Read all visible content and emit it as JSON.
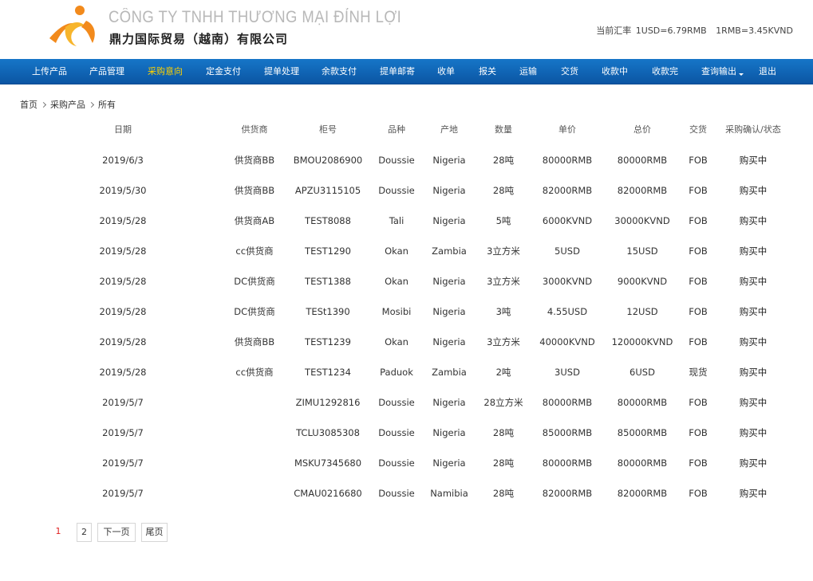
{
  "header": {
    "company_vn": "CÔNG TY TNHH THƯƠNG MẠI ĐỈNH LỢI",
    "company_cn": "鼎力国际贸易（越南）有限公司",
    "rate_label": "当前汇率",
    "rate_usd": "1USD=6.79RMB",
    "rate_rmb": "1RMB=3.45KVND"
  },
  "nav": {
    "items": [
      "上传产品",
      "产品管理",
      "采购意向",
      "定金支付",
      "提单处理",
      "余款支付",
      "提单邮寄",
      "收单",
      "报关",
      "运输",
      "交货",
      "收款中",
      "收款完",
      "查询输出",
      "退出"
    ],
    "active": "采购意向"
  },
  "breadcrumb": [
    "首页",
    "采购产品",
    "所有"
  ],
  "table": {
    "headers": [
      "日期",
      "供货商",
      "柜号",
      "品种",
      "产地",
      "数量",
      "单价",
      "总价",
      "交货",
      "采购确认/状态"
    ],
    "rows": [
      [
        "2019/6/3",
        "供货商BB",
        "BMOU2086900",
        "Doussie",
        "Nigeria",
        "28吨",
        "80000RMB",
        "80000RMB",
        "FOB",
        "购买中"
      ],
      [
        "2019/5/30",
        "供货商BB",
        "APZU3115105",
        "Doussie",
        "Nigeria",
        "28吨",
        "82000RMB",
        "82000RMB",
        "FOB",
        "购买中"
      ],
      [
        "2019/5/28",
        "供货商AB",
        "TEST8088",
        "Tali",
        "Nigeria",
        "5吨",
        "6000KVND",
        "30000KVND",
        "FOB",
        "购买中"
      ],
      [
        "2019/5/28",
        "cc供货商",
        "TEST1290",
        "Okan",
        "Zambia",
        "3立方米",
        "5USD",
        "15USD",
        "FOB",
        "购买中"
      ],
      [
        "2019/5/28",
        "DC供货商",
        "TEST1388",
        "Okan",
        "Nigeria",
        "3立方米",
        "3000KVND",
        "9000KVND",
        "FOB",
        "购买中"
      ],
      [
        "2019/5/28",
        "DC供货商",
        "TESt1390",
        "Mosibi",
        "Nigeria",
        "3吨",
        "4.55USD",
        "12USD",
        "FOB",
        "购买中"
      ],
      [
        "2019/5/28",
        "供货商BB",
        "TEST1239",
        "Okan",
        "Nigeria",
        "3立方米",
        "40000KVND",
        "120000KVND",
        "FOB",
        "购买中"
      ],
      [
        "2019/5/28",
        "cc供货商",
        "TEST1234",
        "Paduok",
        "Zambia",
        "2吨",
        "3USD",
        "6USD",
        "现货",
        "购买中"
      ],
      [
        "2019/5/7",
        "",
        "ZIMU1292816",
        "Doussie",
        "Nigeria",
        "28立方米",
        "80000RMB",
        "80000RMB",
        "FOB",
        "购买中"
      ],
      [
        "2019/5/7",
        "",
        "TCLU3085308",
        "Doussie",
        "Nigeria",
        "28吨",
        "85000RMB",
        "85000RMB",
        "FOB",
        "购买中"
      ],
      [
        "2019/5/7",
        "",
        "MSKU7345680",
        "Doussie",
        "Nigeria",
        "28吨",
        "80000RMB",
        "80000RMB",
        "FOB",
        "购买中"
      ],
      [
        "2019/5/7",
        "",
        "CMAU0216680",
        "Doussie",
        "Namibia",
        "28吨",
        "82000RMB",
        "82000RMB",
        "FOB",
        "购买中"
      ]
    ]
  },
  "pager": {
    "current": "1",
    "page2": "2",
    "next": "下一页",
    "last": "尾页"
  },
  "colors": {
    "nav_bg": "#0b5fb4",
    "nav_active": "#ffd200",
    "logo_orange": "#f28a1c",
    "current_page": "#e02020"
  }
}
